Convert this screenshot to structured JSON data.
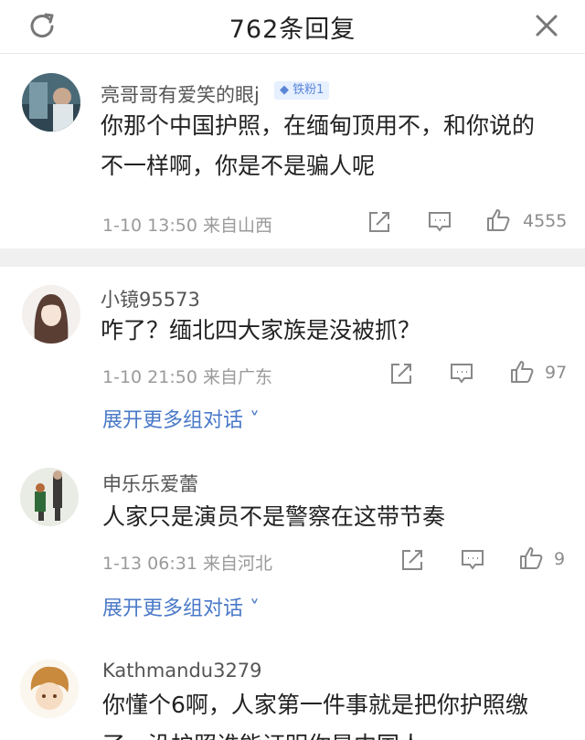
{
  "header": {
    "title": "762条回复",
    "left_icon": "refresh-icon",
    "right_icon": "close-icon"
  },
  "comments": [
    {
      "username": "亮哥哥有爱笑的眼j",
      "badge": "铁粉1",
      "text_lines": [
        "你那个中国护照，在缅甸顶用不，和你说的",
        "不一样啊，你是不是骗人呢"
      ],
      "time": "1-10 13:50",
      "location": "来自山西",
      "likes": "4555"
    },
    {
      "username": "小镜95573",
      "text_lines": [
        "咋了？缅北四大家族是没被抓？"
      ],
      "time": "1-10 21:50",
      "location": "来自广东",
      "likes": "97",
      "expand_label": "展开更多组对话"
    },
    {
      "username": "申乐乐爱蕾",
      "text_lines": [
        "人家只是演员不是警察在这带节奏"
      ],
      "time": "1-13 06:31",
      "location": "来自河北",
      "likes": "9",
      "expand_label": "展开更多组对话"
    },
    {
      "username": "Kathmandu3279",
      "text_lines": [
        "你懂个6啊，人家第一件事就是把你护照缴",
        "了，没护照谁能证明你是中国人"
      ]
    }
  ],
  "colors": {
    "link": "#4a79c8",
    "meta": "#9a9a9a",
    "badge_bg": "#e6f0ff"
  }
}
